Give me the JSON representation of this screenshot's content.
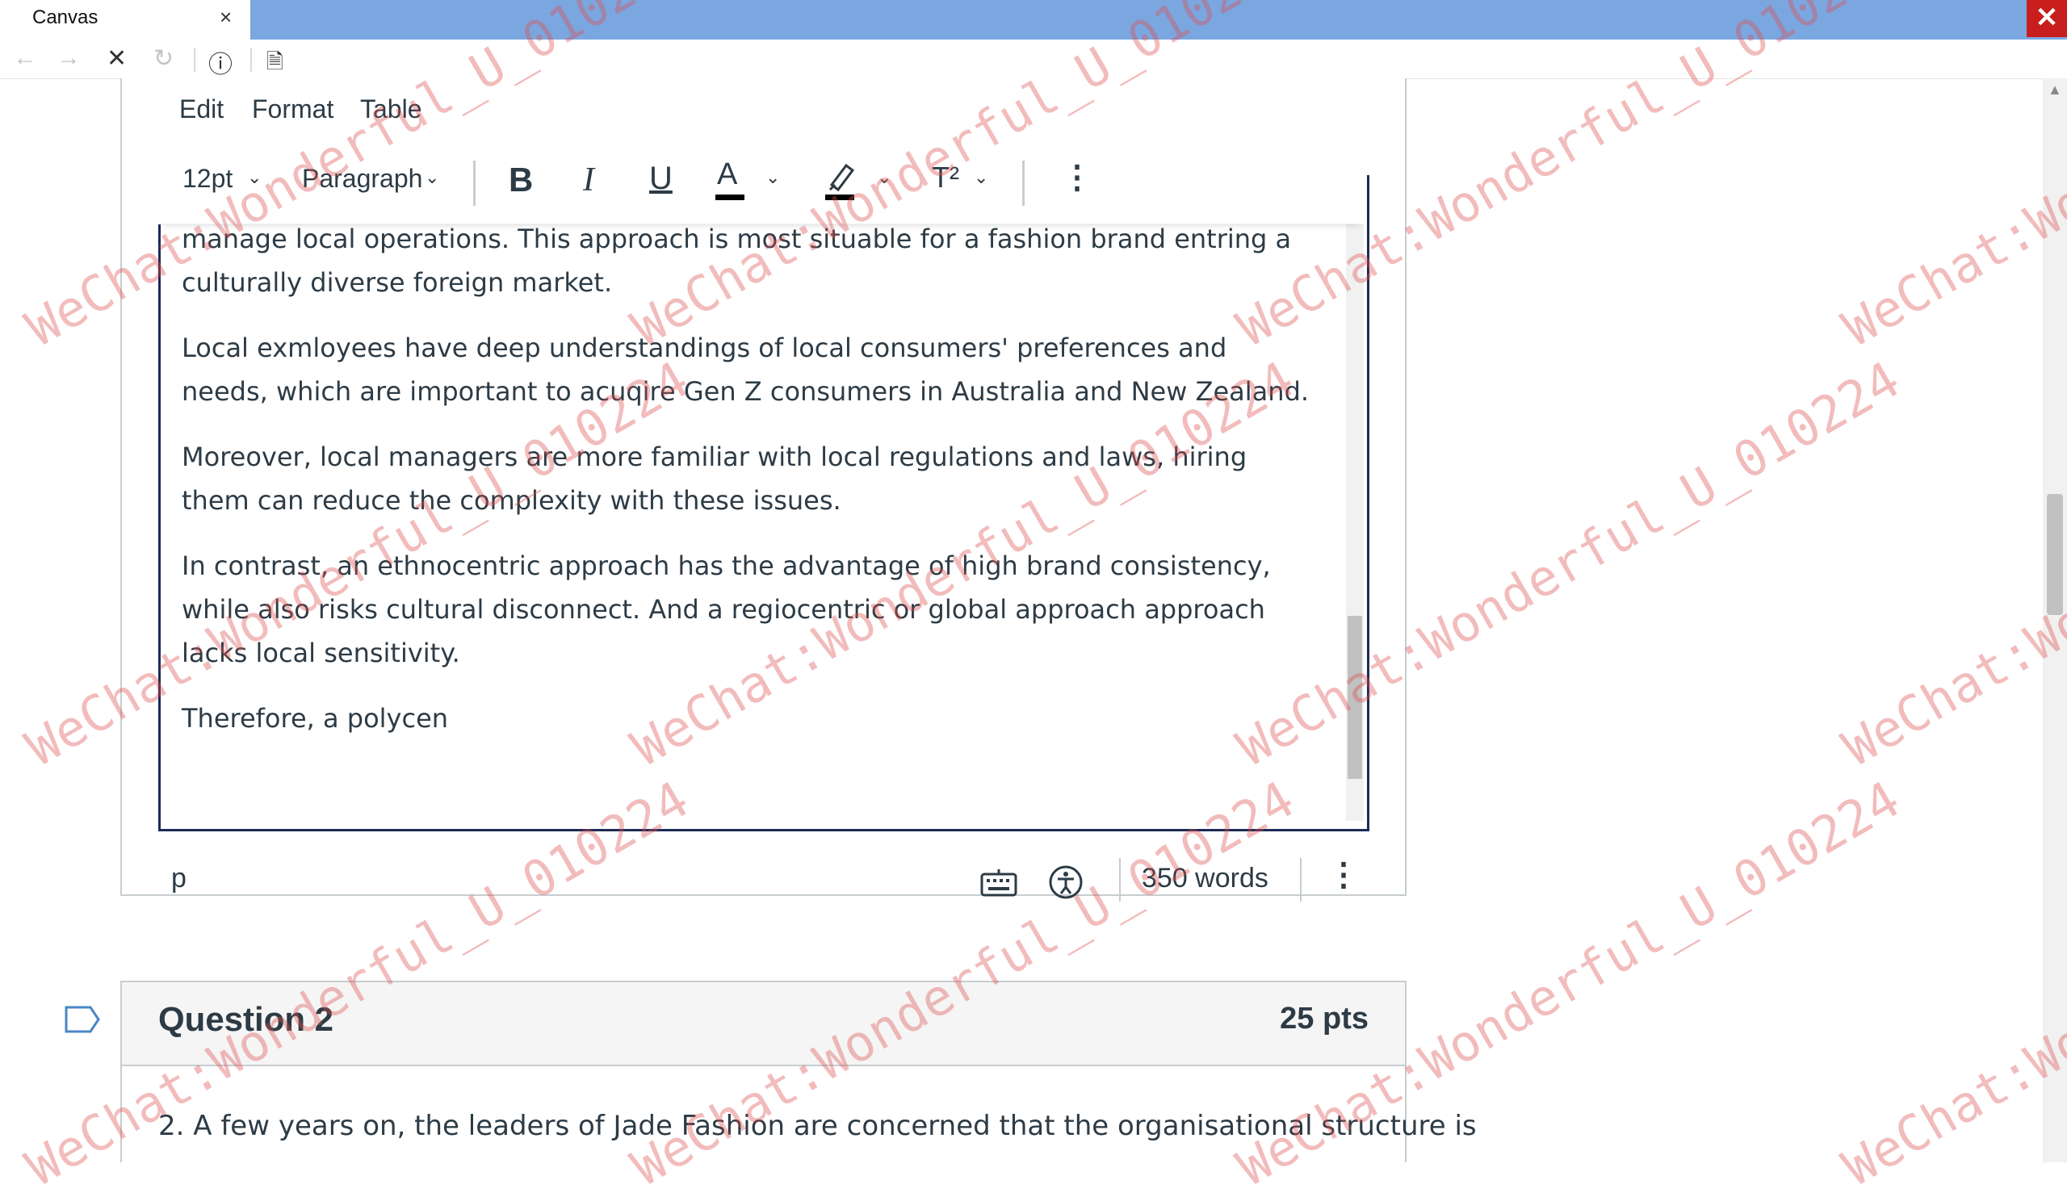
{
  "browser": {
    "tab_title": "Canvas",
    "tab_close": "×",
    "window_close": "✕",
    "nav": {
      "back": "←",
      "forward": "→",
      "stop": "✕",
      "reload": "↻",
      "info": "ⓘ",
      "page": "🗎"
    }
  },
  "editor": {
    "menu": {
      "edit": "Edit",
      "format": "Format",
      "table": "Table"
    },
    "toolbar": {
      "font_size": "12pt",
      "block_format": "Paragraph",
      "bold": "B",
      "italic": "I",
      "underline": "U",
      "text_color": "A",
      "superscript": "T²",
      "more": "⋮",
      "chevron": "⌄",
      "text_color_value": "#000000",
      "highlight_color_value": "#000000"
    },
    "paragraphs": [
      "manage local operations. This approach is most situable for a fashion brand entring a culturally diverse foreign market.",
      "Local exmloyees have deep understandings of local consumers' preferences and needs, which are important to acuqire Gen Z consumers in Australia and New Zealand.",
      "Moreover, local managers are more familiar with local regulations and laws, hiring them can reduce the complexity with these issues.",
      "In contrast, an ethnocentric approach has the advantage of high brand consistency, while also risks cultural disconnect. And a regiocentric or global approach approach lacks local sensitivity.",
      "Therefore, a polycen"
    ],
    "status": {
      "path": "p",
      "word_count": "350 words",
      "resize": "⋮"
    }
  },
  "question2": {
    "title": "Question 2",
    "points": "25 pts",
    "text": "2. A few years on, the leaders of Jade Fashion are concerned that the organisational structure is"
  },
  "watermark_text": "WeChat:Wonderful_U_010224"
}
